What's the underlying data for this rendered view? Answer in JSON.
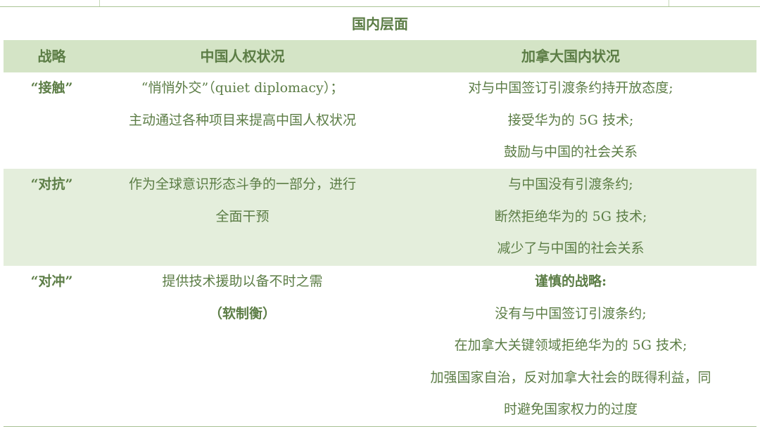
{
  "table": {
    "caption": "国内层面",
    "headers": [
      "战略",
      "中国人权状况",
      "加拿大国内状况"
    ],
    "rows": [
      {
        "strategy": "“接触”",
        "human_rights": [
          "“悄悄外交”（quiet diplomacy）；",
          "主动通过各种项目来提高中国人权状况"
        ],
        "domestic": [
          "对与中国签订引渡条约持开放态度;",
          "接受华为的 5G 技术;",
          "鼓励与中国的社会关系"
        ]
      },
      {
        "strategy": "“对抗”",
        "human_rights": [
          "作为全球意识形态斗争的一部分，进行",
          "全面干预"
        ],
        "domestic": [
          "与中国没有引渡条约;",
          "断然拒绝华为的 5G 技术;",
          "减少了与中国的社会关系"
        ]
      },
      {
        "strategy": "“对冲”",
        "human_rights": [
          "提供技术援助以备不时之需",
          "（软制衡）"
        ],
        "domestic": [
          "谨慎的战略:",
          "没有与中国签订引渡条约;",
          "在加拿大关键领域拒绝华为的 5G 技术;",
          "加强国家自治，反对加拿大社会的既得利益，同",
          "时避免国家权力的过度"
        ]
      }
    ]
  },
  "colors": {
    "header_fill": "#d4e4c6",
    "band_fill": "#e4eedc",
    "text": "#5c7d46",
    "rule": "#a7c092"
  }
}
